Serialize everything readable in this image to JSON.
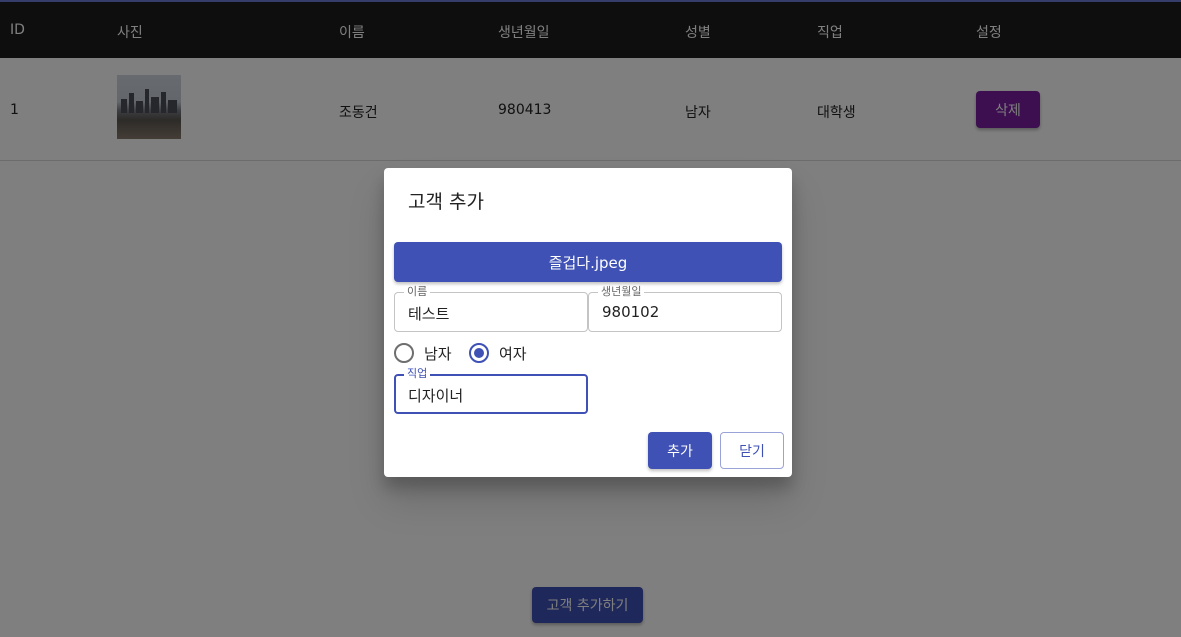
{
  "table": {
    "headers": [
      "ID",
      "사진",
      "이름",
      "생년월일",
      "성별",
      "직업",
      "설정"
    ],
    "rows": [
      {
        "id": "1",
        "name": "조동건",
        "birthday": "980413",
        "gender": "남자",
        "job": "대학생",
        "delete_label": "삭제"
      }
    ]
  },
  "open_dialog_label": "고객 추가하기",
  "dialog": {
    "title": "고객 추가",
    "file_button_label": "즐겁다.jpeg",
    "name_field": {
      "label": "이름",
      "value": "테스트"
    },
    "birthday_field": {
      "label": "생년월일",
      "value": "980102"
    },
    "gender": {
      "options": [
        {
          "label": "남자",
          "checked": false
        },
        {
          "label": "여자",
          "checked": true
        }
      ]
    },
    "job_field": {
      "label": "직업",
      "value": "디자이너"
    },
    "add_label": "추가",
    "close_label": "닫기"
  },
  "colors": {
    "primary": "#3f51b5",
    "delete": "#7b1fa2",
    "header_bg": "#1c1c1c"
  }
}
